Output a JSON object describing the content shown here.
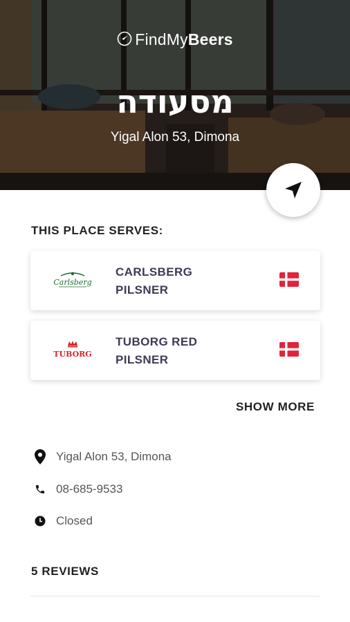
{
  "app": {
    "brand_find": "Find",
    "brand_my": "My",
    "brand_beers": "Beers"
  },
  "venue": {
    "name": "מסעודה",
    "address": "Yigal Alon 53, Dimona"
  },
  "serves": {
    "title": "THIS PLACE SERVES:",
    "beers": [
      {
        "name_line1": "CARLSBERG",
        "name_line2": "PILSNER",
        "logo_text": "Carlsberg",
        "logo_color": "#1b6b2f",
        "flag": "denmark-flag"
      },
      {
        "name_line1": "TUBORG RED",
        "name_line2": "PILSNER",
        "logo_text": "TUBORG",
        "logo_color": "#d8252c",
        "flag": "denmark-flag"
      }
    ],
    "show_more": "SHOW MORE"
  },
  "info": {
    "address": "Yigal Alon 53, Dimona",
    "phone": "08-685-9533",
    "status": "Closed"
  },
  "reviews": {
    "title": "5 REVIEWS"
  },
  "colors": {
    "beer_name": "#3d3b55",
    "flag_red": "#e2233b",
    "text": "#555555",
    "heading": "#222222"
  }
}
